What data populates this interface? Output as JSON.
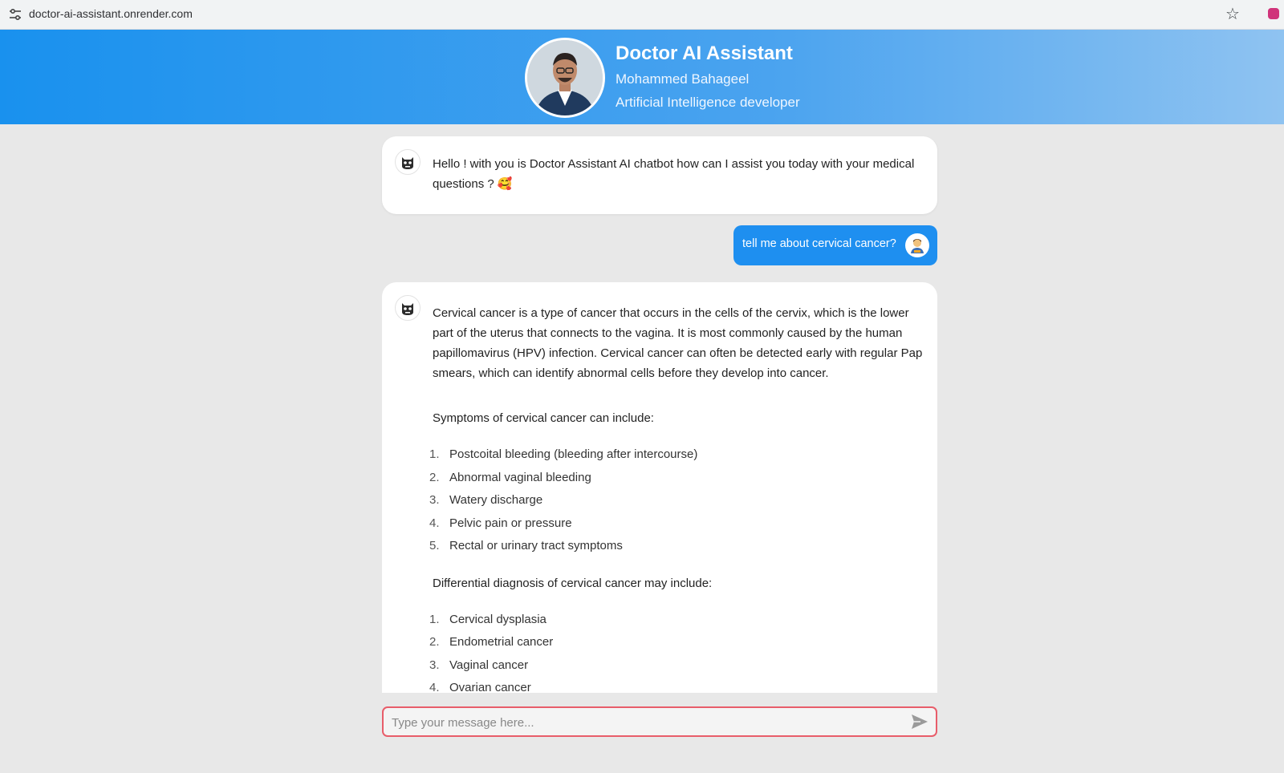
{
  "browser": {
    "url": "doctor-ai-assistant.onrender.com",
    "site_info_icon": "tune-icon",
    "bookmark_icon": "star-icon"
  },
  "header": {
    "title": "Doctor AI Assistant",
    "name": "Mohammed Bahageel",
    "role": "Artificial Intelligence developer",
    "gradient": [
      "#1991ee",
      "#8fc3f1"
    ]
  },
  "chat": {
    "greeting": "Hello ! with you is Doctor Assistant AI chatbot how can I assist you today with your medical questions ? 🥰",
    "user_message": "tell me about cervical cancer?",
    "answer": {
      "intro": "Cervical cancer is a type of cancer that occurs in the cells of the cervix, which is the lower part of the uterus that connects to the vagina. It is most commonly caused by the human papillomavirus (HPV) infection. Cervical cancer can often be detected early with regular Pap smears, which can identify abnormal cells before they develop into cancer.",
      "symptoms_heading": "Symptoms of cervical cancer can include:",
      "symptoms": [
        {
          "num": "1.",
          "text": "Postcoital bleeding (bleeding after intercourse)"
        },
        {
          "num": "2.",
          "text": "Abnormal vaginal bleeding"
        },
        {
          "num": "3.",
          "text": "Watery discharge"
        },
        {
          "num": "4.",
          "text": "Pelvic pain or pressure"
        },
        {
          "num": "5.",
          "text": "Rectal or urinary tract symptoms"
        }
      ],
      "differential_heading": "Differential diagnosis of cervical cancer may include:",
      "differential": [
        {
          "num": "1.",
          "text": "Cervical dysplasia"
        },
        {
          "num": "2.",
          "text": "Endometrial cancer"
        },
        {
          "num": "3.",
          "text": "Vaginal cancer"
        },
        {
          "num": "4.",
          "text": "Ovarian cancer"
        }
      ]
    }
  },
  "input": {
    "placeholder": "Type your message here...",
    "value": "",
    "send_icon": "send-icon",
    "border_color": "#e85d6a"
  },
  "colors": {
    "user_bubble": "#1e8ff0",
    "page_bg": "#e8e8e8"
  }
}
